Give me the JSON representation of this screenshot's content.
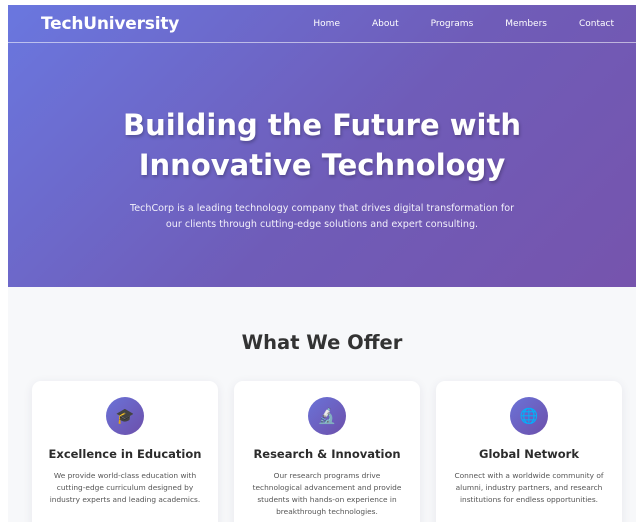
{
  "navbar": {
    "brand": "TechUniversity",
    "links": [
      "Home",
      "About",
      "Programs",
      "Members",
      "Contact"
    ]
  },
  "hero": {
    "title_line1": "Building the Future with",
    "title_line2": "Innovative Technology",
    "subtitle": "TechCorp is a leading technology company that drives digital transformation for our clients through cutting-edge solutions and expert consulting."
  },
  "offer": {
    "title": "What We Offer",
    "cards": [
      {
        "icon": "graduation-cap-icon",
        "glyph": "🎓",
        "title": "Excellence in Education",
        "text": "We provide world-class education with cutting-edge curriculum designed by industry experts and leading academics."
      },
      {
        "icon": "microscope-icon",
        "glyph": "🔬",
        "title": "Research & Innovation",
        "text": "Our research programs drive technological advancement and provide students with hands-on experience in breakthrough technologies."
      },
      {
        "icon": "globe-icon",
        "glyph": "🌐",
        "title": "Global Network",
        "text": "Connect with a worldwide community of alumni, industry partners, and research institutions for endless opportunities."
      }
    ]
  },
  "colors": {
    "hero_gradient_start": "#6a77df",
    "hero_gradient_end": "#7654ad",
    "section_background": "#f7f8fa"
  }
}
